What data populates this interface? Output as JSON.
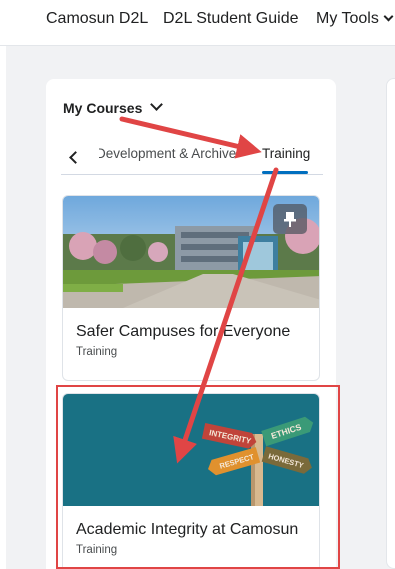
{
  "topnav": {
    "links": [
      "Camosun D2L",
      "D2L Student Guide",
      "My Tools"
    ]
  },
  "widget": {
    "title": "My Courses",
    "tabs": [
      "Development & Archive",
      "Training"
    ],
    "active_tab": "Training"
  },
  "courses": [
    {
      "title": "Safer Campuses for Everyone",
      "subtitle": "Training",
      "image": "campus-photo"
    },
    {
      "title": "Academic Integrity at Camosun",
      "subtitle": "Training",
      "image": "signpost-illustration"
    }
  ],
  "signpost": {
    "words": [
      "INTEGRITY",
      "ETHICS",
      "RESPECT",
      "HONESTY"
    ]
  },
  "colors": {
    "accent": "#006fbf",
    "annotation": "#e04545",
    "card_bg_2": "#1d7b8f"
  }
}
